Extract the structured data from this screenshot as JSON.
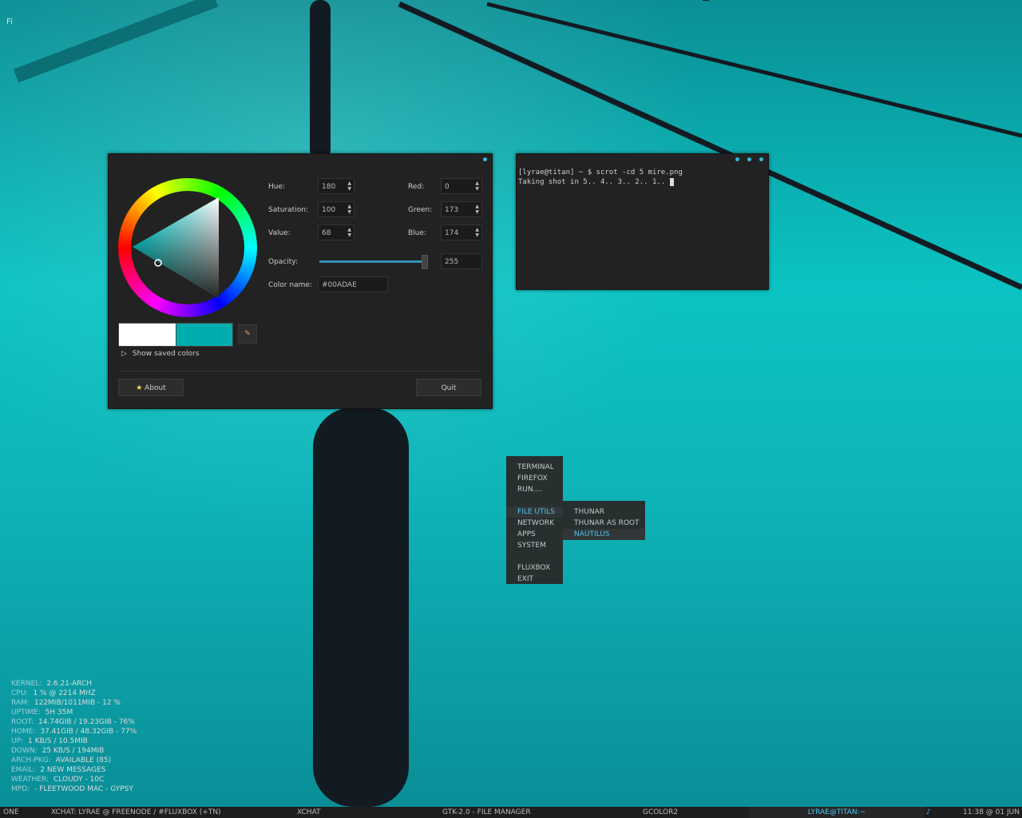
{
  "desktop": {
    "corner_label": "Fi"
  },
  "gcolor": {
    "hue_label": "Hue:",
    "hue": "180",
    "saturation_label": "Saturation:",
    "saturation": "100",
    "value_label": "Value:",
    "value": "68",
    "red_label": "Red:",
    "red": "0",
    "green_label": "Green:",
    "green": "173",
    "blue_label": "Blue:",
    "blue": "174",
    "opacity_label": "Opacity:",
    "opacity": "255",
    "colorname_label": "Color name:",
    "colorname": "#00ADAE",
    "show_saved": "Show saved colors",
    "about_btn": "About",
    "quit_btn": "Quit",
    "accent": "#00ADAE"
  },
  "terminal": {
    "prompt": "[lyrae@titan] ~ $ scrot -cd 5 mire.png",
    "output": "Taking shot in 5.. 4.. 3.. 2.. 1.. "
  },
  "menu": {
    "items": [
      "TERMINAL",
      "FIREFOX",
      "RUN....",
      "FILE UTILS",
      "NETWORK",
      "APPS",
      "SYSTEM",
      "FLUXBOX",
      "EXIT"
    ],
    "submenu": [
      "THUNAR",
      "THUNAR AS ROOT",
      "NAUTILUS"
    ]
  },
  "conky": [
    {
      "k": "KERNEL:",
      "v": "2.6.21-ARCH"
    },
    {
      "k": "CPU:",
      "v": "1 % @ 2214 MHZ"
    },
    {
      "k": "RAM:",
      "v": "122MIB/1011MIB - 12 %"
    },
    {
      "k": "UPTIME:",
      "v": "5H 35M"
    },
    {
      "k": "ROOT:",
      "v": "14.74GIB / 19.23GIB - 76%"
    },
    {
      "k": "HOME:",
      "v": "37.41GIB / 48.32GIB - 77%"
    },
    {
      "k": "UP:",
      "v": "1 KB/S / 10.5MIB"
    },
    {
      "k": "DOWN:",
      "v": "25 KB/S / 194MIB"
    },
    {
      "k": "ARCH-PKG:",
      "v": "AVAILABLE (85)"
    },
    {
      "k": "EMAIL:",
      "v": "2 NEW MESSAGES"
    },
    {
      "k": "WEATHER:",
      "v": "CLOUDY - 10C"
    },
    {
      "k": "MPD:",
      "v": "- FLEETWOOD MAC - GYPSY"
    }
  ],
  "taskbar": {
    "workspace": "ONE",
    "tasks": [
      "XCHAT: LYRAE @ FREENODE / #FLUXBOX (+TN)",
      "XCHAT",
      "GTK-2.0 - FILE MANAGER",
      "GCOLOR2",
      "LYRAE@TITAN:~"
    ],
    "clock": "11:38 @ 01 JUN"
  }
}
